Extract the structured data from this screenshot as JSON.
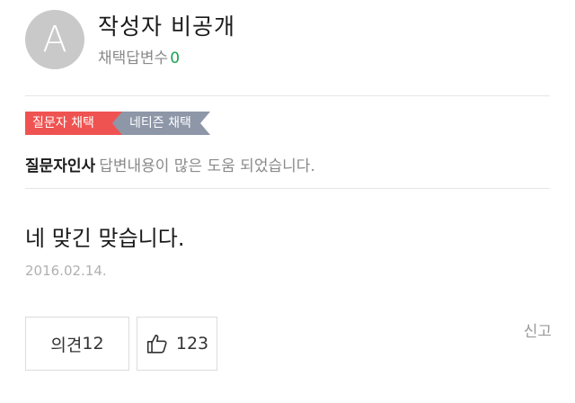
{
  "author": {
    "avatar_letter": "A",
    "name": "작성자 비공개",
    "adopt_label": "채택답변수",
    "adopt_count": "0"
  },
  "badges": {
    "asker": "질문자 채택",
    "netizen": "네티즌 채택",
    "asker_color": "#ef5351",
    "netizen_color": "#8d97a8"
  },
  "greeting": {
    "title": "질문자인사",
    "text": "답변내용이 많은 도움 되었습니다."
  },
  "answer": {
    "text": "네 맞긴 맞습니다.",
    "date": "2016.02.14."
  },
  "actions": {
    "comment_label": "의견",
    "comment_count": "12",
    "like_icon": "thumbs-up-icon",
    "like_count": "123",
    "report_label": "신고"
  }
}
